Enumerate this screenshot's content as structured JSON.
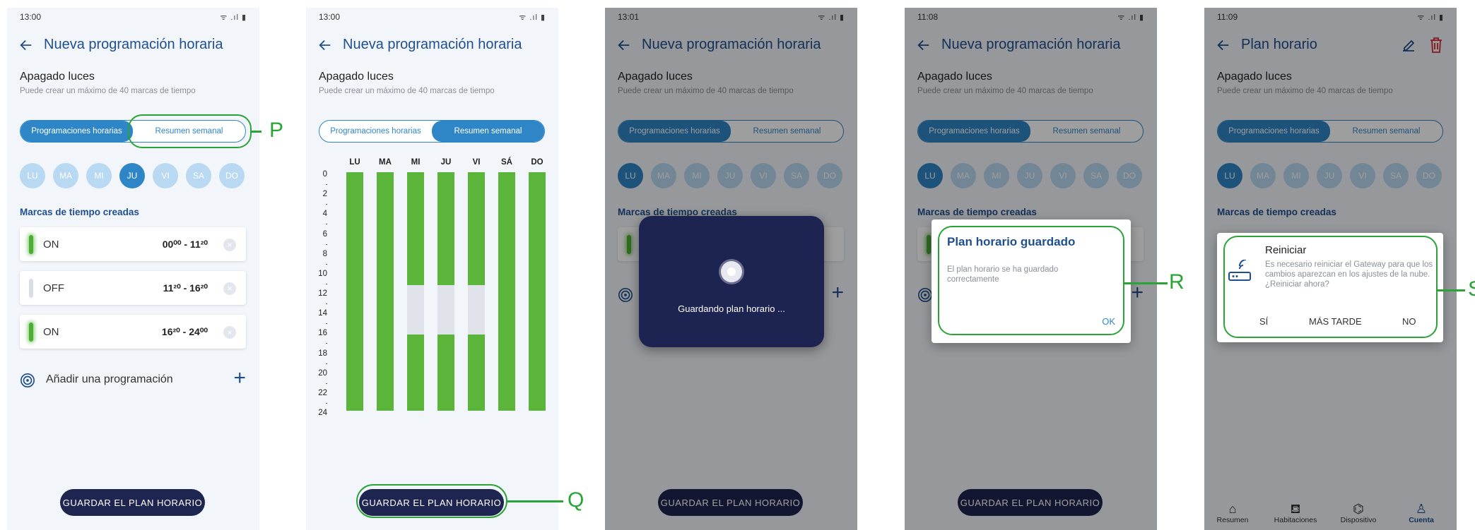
{
  "status": {
    "times": [
      "13:00",
      "13:00",
      "13:01",
      "11:08",
      "11:09"
    ],
    "icons": "ᯤ .ıl ▮"
  },
  "screens": {
    "schedule": {
      "title": "Nueva programación horaria",
      "plan_title": "Plan horario",
      "section_title": "Apagado luces",
      "section_sub": "Puede crear un máximo de 40 marcas de tiempo",
      "tab_schedules": "Programaciones horarias",
      "tab_weekly": "Resumen semanal",
      "days": [
        "LU",
        "MA",
        "MI",
        "JU",
        "VI",
        "SA",
        "DO"
      ],
      "marks_title": "Marcas de tiempo creadas",
      "slots": [
        {
          "state": "ON",
          "range": "00⁰⁰ - 11²⁰",
          "on": true
        },
        {
          "state": "OFF",
          "range": "11²⁰ - 16²⁰",
          "on": false
        },
        {
          "state": "ON",
          "range": "16²⁰ - 24⁰⁰",
          "on": true
        }
      ],
      "add_label": "Añadir una programación",
      "add_symbol": "+",
      "clear_symbol": "×",
      "save_button": "GUARDAR EL PLAN HORARIO"
    },
    "weekly": {
      "day_headers": [
        "LU",
        "MA",
        "MI",
        "JU",
        "VI",
        "SÁ",
        "DO"
      ],
      "y_ticks": [
        "0",
        "2",
        "4",
        "6",
        "8",
        "10",
        "12",
        "14",
        "16",
        "18",
        "20",
        "22",
        "24"
      ]
    },
    "saving": {
      "text": "Guardando plan horario ..."
    },
    "saved_dialog": {
      "title": "Plan horario guardado",
      "body": "El plan horario se ha guardado correctamente",
      "ok": "OK"
    },
    "reset_dialog": {
      "title": "Reiniciar",
      "body": "Es necesario reiniciar el Gateway para que los cambios aparezcan en los ajustes de la nube. ¿Reiniciar ahora?",
      "yes": "SÍ",
      "later": "MÁS TARDE",
      "no": "NO"
    },
    "bottom_nav": [
      "Resumen",
      "Habitaciones",
      "Dispositivo",
      "Cuenta"
    ]
  },
  "chart_data": {
    "type": "bar",
    "categories": [
      "LU",
      "MA",
      "MI",
      "JU",
      "VI",
      "SÁ",
      "DO"
    ],
    "ylim": [
      0,
      24
    ],
    "series": [
      {
        "values": [
          [
            0,
            24
          ],
          [
            0,
            24
          ],
          [
            0,
            11.33,
            16.33,
            24
          ],
          [
            0,
            11.33,
            16.33,
            24
          ],
          [
            0,
            11.33,
            16.33,
            24
          ],
          [
            0,
            24
          ],
          [
            0,
            24
          ]
        ]
      }
    ]
  },
  "callouts": [
    "P",
    "Q",
    "R",
    "S"
  ],
  "colors": {
    "accent": "#2f86c7",
    "title_blue": "#1f4f8f",
    "on_green": "#5bb53b",
    "dark_button": "#1e2550",
    "callout_green": "#2aa437",
    "delete_red": "#d9262a"
  }
}
